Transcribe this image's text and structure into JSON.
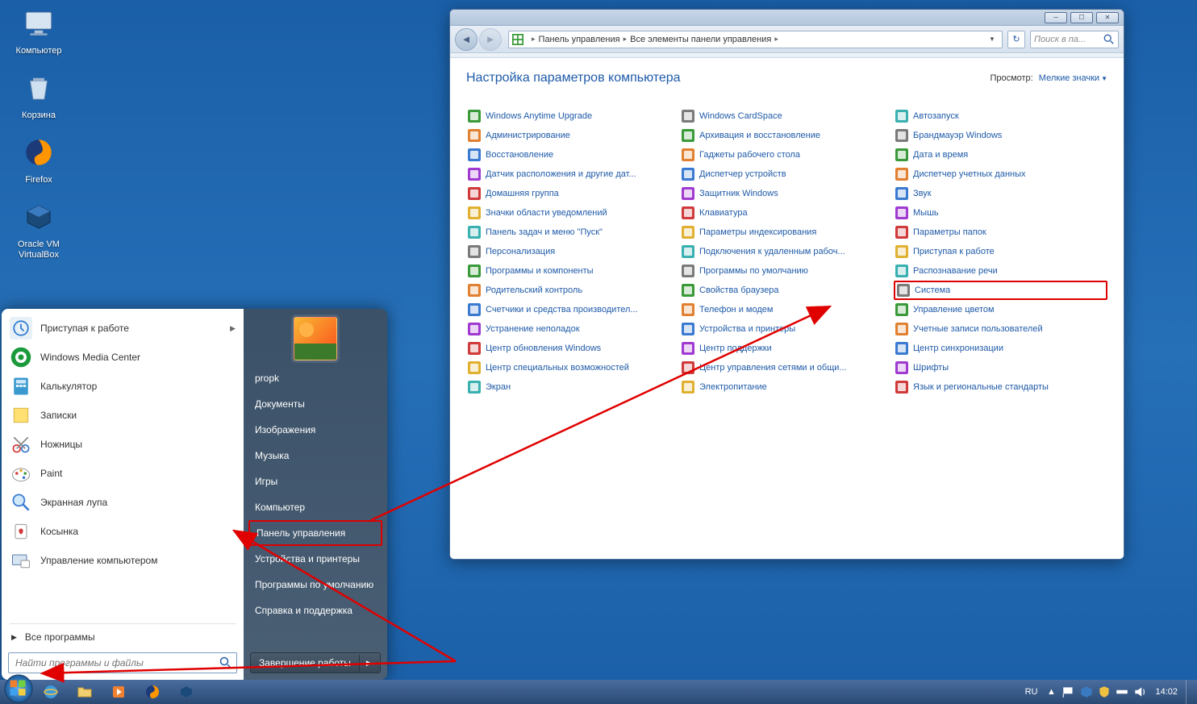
{
  "desktop": {
    "icons": [
      {
        "label": "Компьютер"
      },
      {
        "label": "Корзина"
      },
      {
        "label": "Firefox"
      },
      {
        "label": "Oracle VM\nVirtualBox"
      }
    ]
  },
  "start_menu": {
    "left_items": [
      {
        "label": "Приступая к работе",
        "has_arrow": true
      },
      {
        "label": "Windows Media Center"
      },
      {
        "label": "Калькулятор"
      },
      {
        "label": "Записки"
      },
      {
        "label": "Ножницы"
      },
      {
        "label": "Paint"
      },
      {
        "label": "Экранная лупа"
      },
      {
        "label": "Косынка"
      },
      {
        "label": "Управление компьютером"
      }
    ],
    "all_programs": "Все программы",
    "search_placeholder": "Найти программы и файлы",
    "username": "propk",
    "right_items": [
      "Документы",
      "Изображения",
      "Музыка",
      "Игры",
      "Компьютер",
      "Панель управления",
      "Устройства и принтеры",
      "Программы по умолчанию",
      "Справка и поддержка"
    ],
    "shutdown": "Завершение работы"
  },
  "control_panel": {
    "breadcrumb": [
      "Панель управления",
      "Все элементы панели управления"
    ],
    "search_placeholder": "Поиск в па...",
    "heading": "Настройка параметров компьютера",
    "view_label": "Просмотр:",
    "view_value": "Мелкие значки",
    "columns": [
      [
        "Windows Anytime Upgrade",
        "Администрирование",
        "Восстановление",
        "Датчик расположения и другие дат...",
        "Домашняя группа",
        "Значки области уведомлений",
        "Панель задач и меню \"Пуск\"",
        "Персонализация",
        "Программы и компоненты",
        "Родительский контроль",
        "Счетчики и средства производител...",
        "Устранение неполадок",
        "Центр обновления Windows",
        "Центр специальных возможностей",
        "Экран"
      ],
      [
        "Windows CardSpace",
        "Архивация и восстановление",
        "Гаджеты рабочего стола",
        "Диспетчер устройств",
        "Защитник Windows",
        "Клавиатура",
        "Параметры индексирования",
        "Подключения к удаленным рабоч...",
        "Программы по умолчанию",
        "Свойства браузера",
        "Телефон и модем",
        "Устройства и принтеры",
        "Центр поддержки",
        "Центр управления сетями и общи...",
        "Электропитание"
      ],
      [
        "Автозапуск",
        "Брандмауэр Windows",
        "Дата и время",
        "Диспетчер учетных данных",
        "Звук",
        "Мышь",
        "Параметры папок",
        "Приступая к работе",
        "Распознавание речи",
        "Система",
        "Управление цветом",
        "Учетные записи пользователей",
        "Центр синхронизации",
        "Шрифты",
        "Язык и региональные стандарты"
      ]
    ]
  },
  "taskbar": {
    "lang": "RU",
    "time": "14:02"
  }
}
